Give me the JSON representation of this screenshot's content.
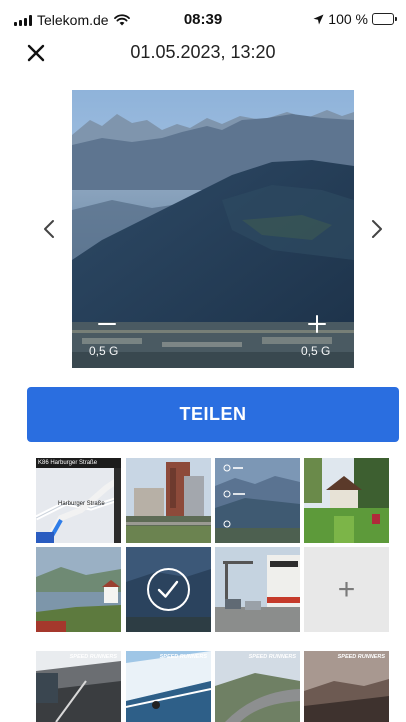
{
  "status_bar": {
    "carrier": "Telekom.de",
    "time": "08:39",
    "battery": "100 %",
    "battery_level": 1.0
  },
  "header": {
    "title": "01.05.2023, 13:20"
  },
  "photo_viewer": {
    "zoom_left_value": "0,5 G",
    "zoom_right_value": "0,5 G"
  },
  "share_button": {
    "label": "TEILEN"
  },
  "grid": {
    "map_thumb": {
      "street_top": "K86 Harburger Straße",
      "street_mid": "Harburger Straße"
    },
    "badge_text": "SPEED RUNNERS",
    "add_label": "+"
  },
  "colors": {
    "accent": "#2a6ee0",
    "add_tile_bg": "#e8e8e8"
  }
}
